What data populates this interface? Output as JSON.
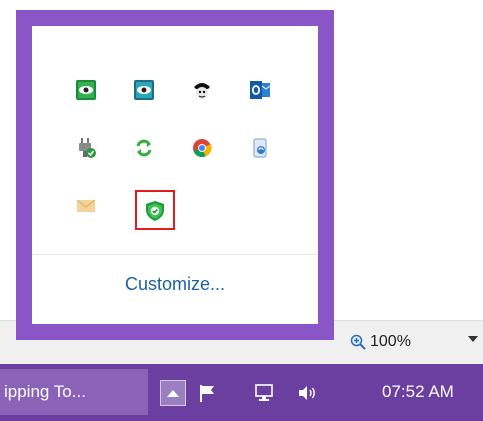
{
  "flyout": {
    "icons": [
      {
        "name": "eye-green-icon",
        "label": ""
      },
      {
        "name": "eye-teal-icon",
        "label": ""
      },
      {
        "name": "pirate-mascot-icon",
        "label": ""
      },
      {
        "name": "outlook-icon",
        "label": ""
      },
      {
        "name": "power-plug-check-icon",
        "label": ""
      },
      {
        "name": "sync-arrows-icon",
        "label": ""
      },
      {
        "name": "chrome-icon",
        "label": ""
      },
      {
        "name": "phone-sync-icon",
        "label": ""
      },
      {
        "name": "envelope-icon",
        "label": ""
      },
      {
        "name": "security-shield-icon",
        "label": ""
      }
    ],
    "customize_label": "Customize..."
  },
  "status": {
    "zoom_label": "100%"
  },
  "taskbar": {
    "task_button_label": "ipping To...",
    "clock_label": "07:52 AM"
  },
  "colors": {
    "flyout_border": "#8a55c6",
    "taskbar": "#6b3fa0",
    "link": "#1f5fa8",
    "selection": "#e21b1b"
  }
}
